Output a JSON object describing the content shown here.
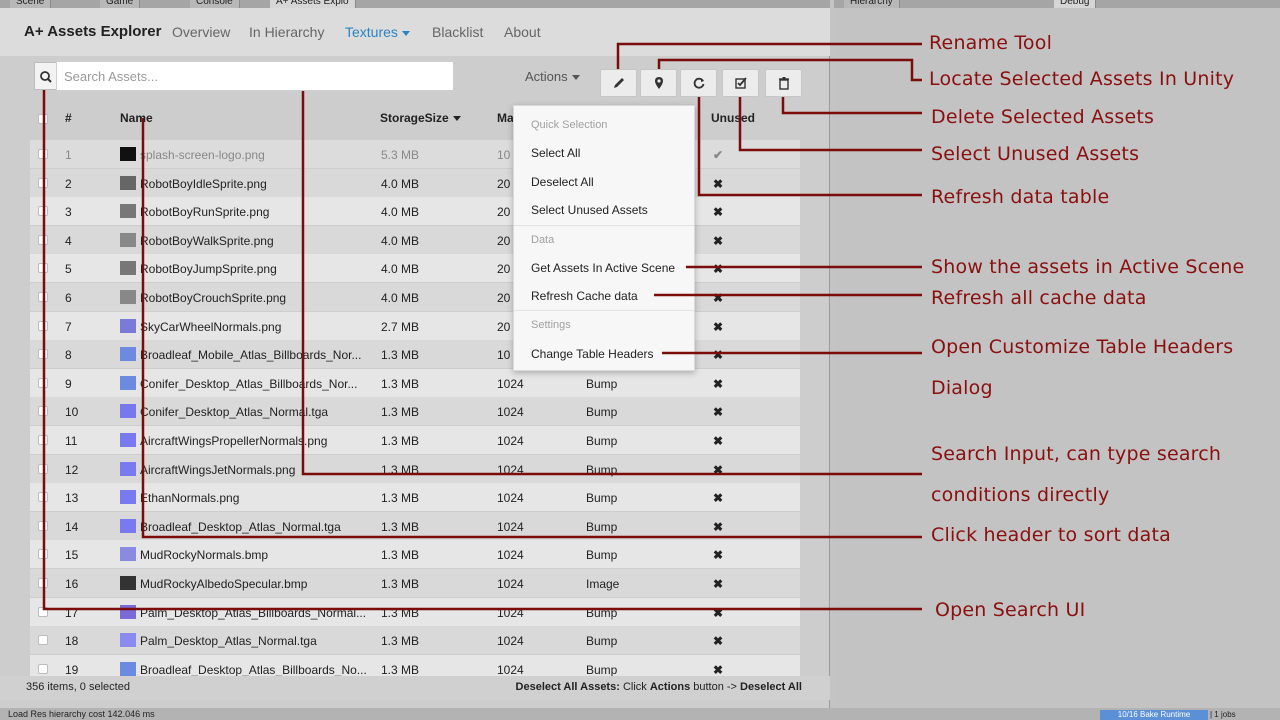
{
  "unity_tabs": [
    "Scene",
    "Game",
    "Console",
    "A+ Assets Explo"
  ],
  "right_tabs": [
    "Hierarchy",
    "Debug"
  ],
  "nav": {
    "brand": "A+ Assets Explorer",
    "links": [
      "Overview",
      "In Hierarchy",
      "Textures",
      "Blacklist",
      "About"
    ]
  },
  "search": {
    "placeholder": "Search Assets..."
  },
  "toolbar": {
    "actions_label": "Actions"
  },
  "table": {
    "headers": {
      "num": "#",
      "name": "Name",
      "size": "StorageSize",
      "max": "Ma",
      "unused": "Unused"
    },
    "rows": [
      {
        "num": "1",
        "name": "splash-screen-logo.png",
        "size": "5.3 MB",
        "max": "10",
        "type": "",
        "unused": "✔"
      },
      {
        "num": "2",
        "name": "RobotBoyIdleSprite.png",
        "size": "4.0 MB",
        "max": "20",
        "type": "",
        "unused": "✖"
      },
      {
        "num": "3",
        "name": "RobotBoyRunSprite.png",
        "size": "4.0 MB",
        "max": "20",
        "type": "",
        "unused": "✖"
      },
      {
        "num": "4",
        "name": "RobotBoyWalkSprite.png",
        "size": "4.0 MB",
        "max": "20",
        "type": "",
        "unused": "✖"
      },
      {
        "num": "5",
        "name": "RobotBoyJumpSprite.png",
        "size": "4.0 MB",
        "max": "20",
        "type": "",
        "unused": "✖"
      },
      {
        "num": "6",
        "name": "RobotBoyCrouchSprite.png",
        "size": "4.0 MB",
        "max": "20",
        "type": "",
        "unused": "✖"
      },
      {
        "num": "7",
        "name": "SkyCarWheelNormals.png",
        "size": "2.7 MB",
        "max": "20",
        "type": "",
        "unused": "✖"
      },
      {
        "num": "8",
        "name": "Broadleaf_Mobile_Atlas_Billboards_Nor...",
        "size": "1.3 MB",
        "max": "10",
        "type": "",
        "unused": "✖"
      },
      {
        "num": "9",
        "name": "Conifer_Desktop_Atlas_Billboards_Nor...",
        "size": "1.3 MB",
        "max": "1024",
        "type": "Bump",
        "unused": "✖"
      },
      {
        "num": "10",
        "name": "Conifer_Desktop_Atlas_Normal.tga",
        "size": "1.3 MB",
        "max": "1024",
        "type": "Bump",
        "unused": "✖"
      },
      {
        "num": "11",
        "name": "AircraftWingsPropellerNormals.png",
        "size": "1.3 MB",
        "max": "1024",
        "type": "Bump",
        "unused": "✖"
      },
      {
        "num": "12",
        "name": "AircraftWingsJetNormals.png",
        "size": "1.3 MB",
        "max": "1024",
        "type": "Bump",
        "unused": "✖"
      },
      {
        "num": "13",
        "name": "EthanNormals.png",
        "size": "1.3 MB",
        "max": "1024",
        "type": "Bump",
        "unused": "✖"
      },
      {
        "num": "14",
        "name": "Broadleaf_Desktop_Atlas_Normal.tga",
        "size": "1.3 MB",
        "max": "1024",
        "type": "Bump",
        "unused": "✖"
      },
      {
        "num": "15",
        "name": "MudRockyNormals.bmp",
        "size": "1.3 MB",
        "max": "1024",
        "type": "Bump",
        "unused": "✖"
      },
      {
        "num": "16",
        "name": "MudRockyAlbedoSpecular.bmp",
        "size": "1.3 MB",
        "max": "1024",
        "type": "Image",
        "unused": "✖"
      },
      {
        "num": "17",
        "name": "Palm_Desktop_Atlas_Billboards_Normal...",
        "size": "1.3 MB",
        "max": "1024",
        "type": "Bump",
        "unused": "✖"
      },
      {
        "num": "18",
        "name": "Palm_Desktop_Atlas_Normal.tga",
        "size": "1.3 MB",
        "max": "1024",
        "type": "Bump",
        "unused": "✖"
      },
      {
        "num": "19",
        "name": "Broadleaf_Desktop_Atlas_Billboards_No...",
        "size": "1.3 MB",
        "max": "1024",
        "type": "Bump",
        "unused": "✖"
      }
    ]
  },
  "menu": {
    "quick_selection": "Quick Selection",
    "select_all": "Select All",
    "deselect_all": "Deselect All",
    "select_unused": "Select Unused Assets",
    "data": "Data",
    "get_active_scene": "Get Assets In Active Scene",
    "refresh_cache": "Refresh Cache data",
    "settings": "Settings",
    "change_headers": "Change Table Headers"
  },
  "status": {
    "left": "356 items, 0 selected",
    "right_prefix": "Deselect All Assets:",
    "right_mid1": " Click ",
    "right_actions": "Actions",
    "right_mid2": " button -> ",
    "right_end": "Deselect All"
  },
  "console": {
    "message": "Load Res hierarchy cost 142.046 ms",
    "bake": "10/16 Bake Runtime",
    "jobs": "| 1 jobs"
  },
  "annotations": {
    "rename": "Rename Tool",
    "locate": "Locate Selected Assets In Unity",
    "delete": "Delete Selected Assets",
    "select_unused": "Select Unused Assets",
    "refresh_table": "Refresh data table",
    "show_active": "Show the assets in Active Scene",
    "refresh_cache": "Refresh all cache data",
    "open_headers_1": "Open Customize Table Headers",
    "open_headers_2": "Dialog",
    "search_input_1": "Search Input, can type search",
    "search_input_2": "conditions directly",
    "click_header": "Click header to sort data",
    "open_search": "Open Search UI"
  },
  "colors": {
    "accent": "#2b83c4",
    "annotation": "#8a0f0f"
  }
}
